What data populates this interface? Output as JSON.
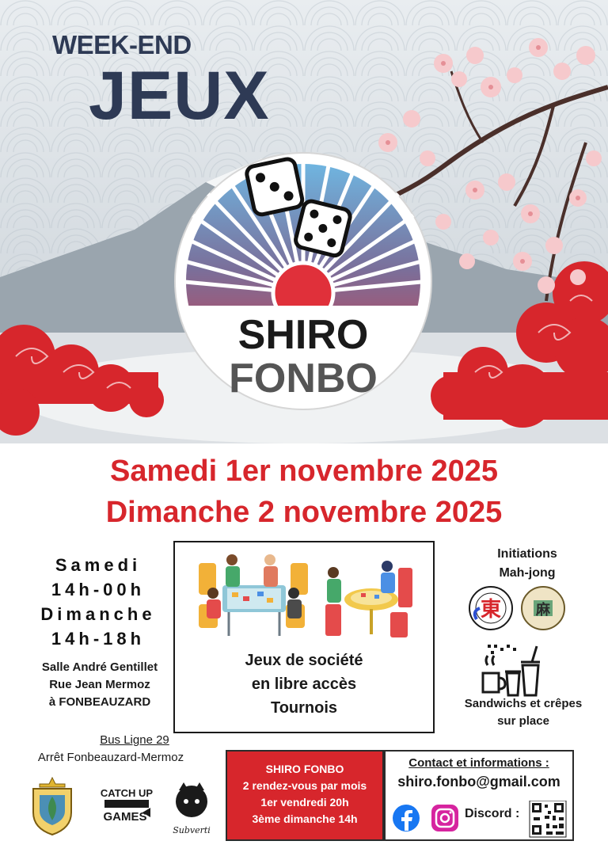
{
  "hero": {
    "headline_small": "WEEK-END",
    "headline_big": "JEUX",
    "logo_line1": "SHIRO",
    "logo_line2": "FONBO"
  },
  "dates": {
    "line1": "Samedi 1er novembre 2025",
    "line2": "Dimanche 2 novembre 2025",
    "color": "#d7262c"
  },
  "schedule": {
    "day1": "Samedi",
    "hours1": "14h-00h",
    "day2": "Dimanche",
    "hours2": "14h-18h"
  },
  "venue": {
    "line1": "Salle André Gentillet",
    "line2": "Rue Jean Mermoz",
    "line3": "à FONBEAUZARD"
  },
  "transport": {
    "bus_line": "Bus Ligne 29",
    "stop": "Arrêt Fonbeauzard-Mermoz"
  },
  "activities": {
    "line1": "Jeux de société",
    "line2": "en libre accès",
    "line3": "Tournois"
  },
  "initiations": {
    "line1": "Initiations",
    "line2": "Mah-jong",
    "club1_glyph": "東",
    "club2_glyph": "麻"
  },
  "food": {
    "line1": "Sandwichs et crêpes",
    "line2": "sur place"
  },
  "sponsors": {
    "catchup_line1": "CATCH UP",
    "catchup_line2": "GAMES",
    "subverti": "Subverti"
  },
  "club_info": {
    "name": "SHIRO FONBO",
    "line1": "2 rendez-vous par mois",
    "line2": "1er vendredi 20h",
    "line3": "3ème dimanche 14h"
  },
  "contact": {
    "title": "Contact et informations :",
    "email": "shiro.fonbo@gmail.com",
    "discord_label": "Discord :"
  },
  "colors": {
    "red": "#d7262c",
    "navy": "#2e3a55",
    "facebook": "#1877f2"
  }
}
